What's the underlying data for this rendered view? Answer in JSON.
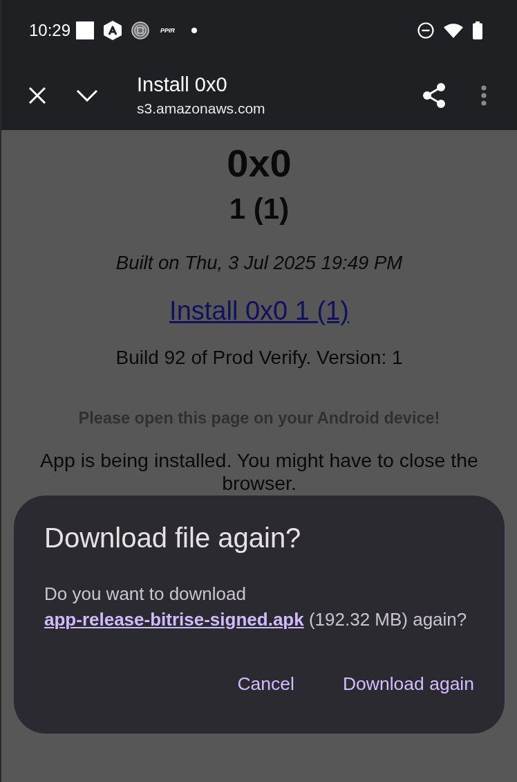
{
  "status_bar": {
    "time": "10:29",
    "notification_text": "PPIR"
  },
  "toolbar": {
    "title": "Install 0x0",
    "url": "s3.amazonaws.com"
  },
  "page": {
    "app_name": "0x0",
    "version": "1 (1)",
    "built_on": "Built on Thu, 3 Jul 2025 19:49 PM",
    "install_link": "Install 0x0 1 (1)",
    "build_info": "Build 92 of Prod Verify. Version: 1",
    "warning": "Please open this page on your Android device!",
    "status_message": "App is being installed. You might have to close the browser."
  },
  "dialog": {
    "title": "Download file again?",
    "message_before": "Do you want to download",
    "file_link": "app-release-bitrise-signed.apk",
    "message_after": "(192.32 MB) again?",
    "buttons": [
      "Cancel",
      "Download again"
    ]
  }
}
